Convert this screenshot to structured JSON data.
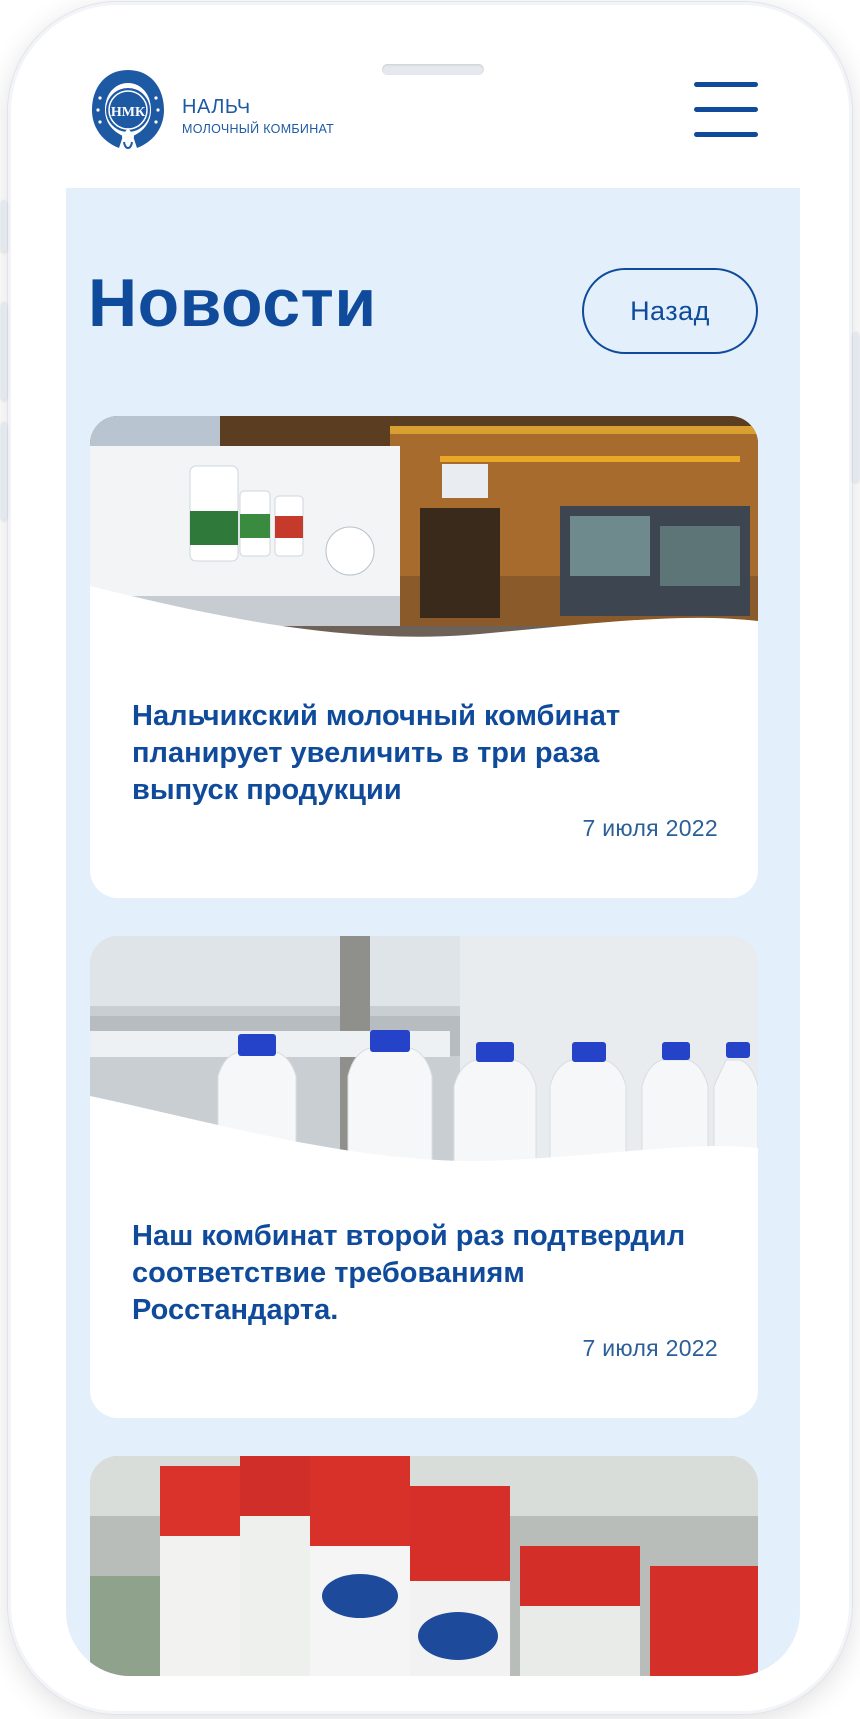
{
  "brand": {
    "name": "НАЛЬЧ",
    "subtitle": "МОЛОЧНЫЙ КОМБИНАТ",
    "logo_letters": "НМК"
  },
  "page": {
    "title": "Новости",
    "back_label": "Назад"
  },
  "news": [
    {
      "title": "Нальчикский молочный комбинат планирует увеличить в три раза выпуск продукции",
      "date": "7 июля 2022",
      "image": "milk-truck-warehouse-photo"
    },
    {
      "title": "Наш комбинат второй раз подтвердил соответствие требованиям Росстандарта.",
      "date": "7 июля 2022",
      "image": "milk-bottles-conveyor-photo"
    },
    {
      "image": "milk-cartons-conveyor-photo"
    }
  ],
  "icons": {
    "menu": "hamburger-menu-icon",
    "logo": "horseshoe-logo-icon"
  },
  "colors": {
    "brand_blue": "#0f4b9a",
    "screen_bg": "#e3f0fc",
    "card_bg": "#ffffff"
  }
}
